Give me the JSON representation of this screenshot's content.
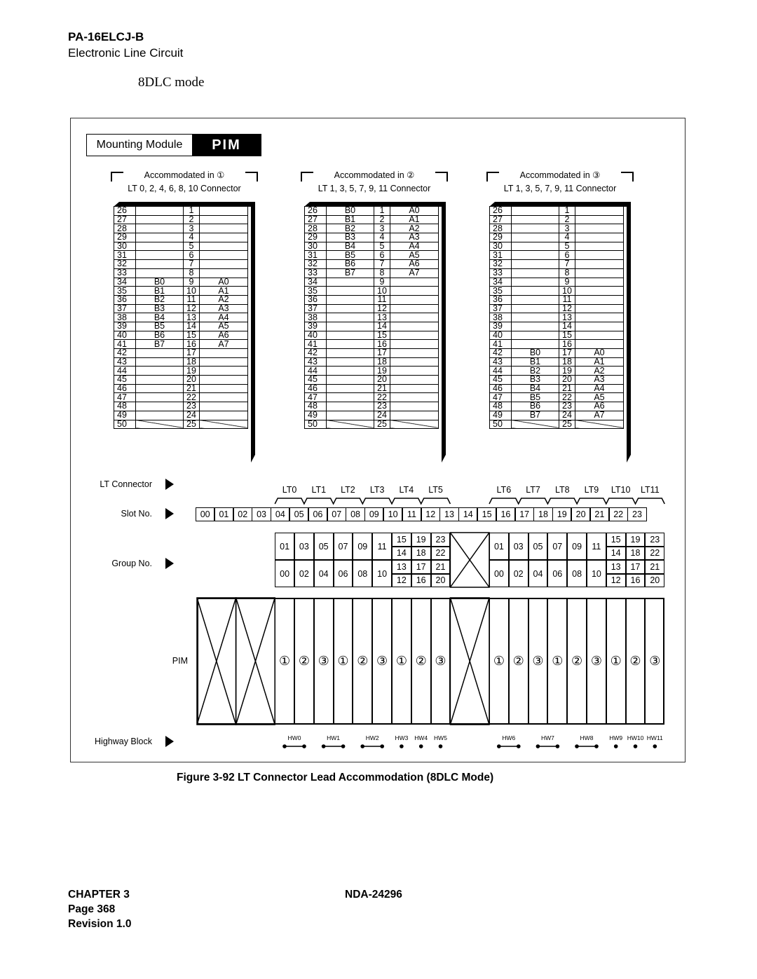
{
  "header": {
    "code": "PA-16ELCJ-B",
    "subtitle": "Electronic Line Circuit",
    "mode": "8DLC mode"
  },
  "mounting_module": {
    "label": "Mounting Module",
    "value": "PIM"
  },
  "connectors": [
    {
      "accommodated": "Accommodated in ①",
      "lt_label": "LT 0, 2, 4, 6, 8, 10 Connector",
      "rows": [
        [
          "26",
          "",
          "1",
          ""
        ],
        [
          "27",
          "",
          "2",
          ""
        ],
        [
          "28",
          "",
          "3",
          ""
        ],
        [
          "29",
          "",
          "4",
          ""
        ],
        [
          "30",
          "",
          "5",
          ""
        ],
        [
          "31",
          "",
          "6",
          ""
        ],
        [
          "32",
          "",
          "7",
          ""
        ],
        [
          "33",
          "",
          "8",
          ""
        ],
        [
          "34",
          "B0",
          "9",
          "A0"
        ],
        [
          "35",
          "B1",
          "10",
          "A1"
        ],
        [
          "36",
          "B2",
          "11",
          "A2"
        ],
        [
          "37",
          "B3",
          "12",
          "A3"
        ],
        [
          "38",
          "B4",
          "13",
          "A4"
        ],
        [
          "39",
          "B5",
          "14",
          "A5"
        ],
        [
          "40",
          "B6",
          "15",
          "A6"
        ],
        [
          "41",
          "B7",
          "16",
          "A7"
        ],
        [
          "42",
          "",
          "17",
          ""
        ],
        [
          "43",
          "",
          "18",
          ""
        ],
        [
          "44",
          "",
          "19",
          ""
        ],
        [
          "45",
          "",
          "20",
          ""
        ],
        [
          "46",
          "",
          "21",
          ""
        ],
        [
          "47",
          "",
          "22",
          ""
        ],
        [
          "48",
          "",
          "23",
          ""
        ],
        [
          "49",
          "",
          "24",
          ""
        ],
        [
          "50",
          "",
          "25",
          ""
        ]
      ]
    },
    {
      "accommodated": "Accommodated in ②",
      "lt_label": "LT 1, 3, 5, 7, 9, 11 Connector",
      "rows": [
        [
          "26",
          "B0",
          "1",
          "A0"
        ],
        [
          "27",
          "B1",
          "2",
          "A1"
        ],
        [
          "28",
          "B2",
          "3",
          "A2"
        ],
        [
          "29",
          "B3",
          "4",
          "A3"
        ],
        [
          "30",
          "B4",
          "5",
          "A4"
        ],
        [
          "31",
          "B5",
          "6",
          "A5"
        ],
        [
          "32",
          "B6",
          "7",
          "A6"
        ],
        [
          "33",
          "B7",
          "8",
          "A7"
        ],
        [
          "34",
          "",
          "9",
          ""
        ],
        [
          "35",
          "",
          "10",
          ""
        ],
        [
          "36",
          "",
          "11",
          ""
        ],
        [
          "37",
          "",
          "12",
          ""
        ],
        [
          "38",
          "",
          "13",
          ""
        ],
        [
          "39",
          "",
          "14",
          ""
        ],
        [
          "40",
          "",
          "15",
          ""
        ],
        [
          "41",
          "",
          "16",
          ""
        ],
        [
          "42",
          "",
          "17",
          ""
        ],
        [
          "43",
          "",
          "18",
          ""
        ],
        [
          "44",
          "",
          "19",
          ""
        ],
        [
          "45",
          "",
          "20",
          ""
        ],
        [
          "46",
          "",
          "21",
          ""
        ],
        [
          "47",
          "",
          "22",
          ""
        ],
        [
          "48",
          "",
          "23",
          ""
        ],
        [
          "49",
          "",
          "24",
          ""
        ],
        [
          "50",
          "",
          "25",
          ""
        ]
      ]
    },
    {
      "accommodated": "Accommodated in ③",
      "lt_label": "LT 1, 3, 5, 7, 9, 11 Connector",
      "rows": [
        [
          "26",
          "",
          "1",
          ""
        ],
        [
          "27",
          "",
          "2",
          ""
        ],
        [
          "28",
          "",
          "3",
          ""
        ],
        [
          "29",
          "",
          "4",
          ""
        ],
        [
          "30",
          "",
          "5",
          ""
        ],
        [
          "31",
          "",
          "6",
          ""
        ],
        [
          "32",
          "",
          "7",
          ""
        ],
        [
          "33",
          "",
          "8",
          ""
        ],
        [
          "34",
          "",
          "9",
          ""
        ],
        [
          "35",
          "",
          "10",
          ""
        ],
        [
          "36",
          "",
          "11",
          ""
        ],
        [
          "37",
          "",
          "12",
          ""
        ],
        [
          "38",
          "",
          "13",
          ""
        ],
        [
          "39",
          "",
          "14",
          ""
        ],
        [
          "40",
          "",
          "15",
          ""
        ],
        [
          "41",
          "",
          "16",
          ""
        ],
        [
          "42",
          "B0",
          "17",
          "A0"
        ],
        [
          "43",
          "B1",
          "18",
          "A1"
        ],
        [
          "44",
          "B2",
          "19",
          "A2"
        ],
        [
          "45",
          "B3",
          "20",
          "A3"
        ],
        [
          "46",
          "B4",
          "21",
          "A4"
        ],
        [
          "47",
          "B5",
          "22",
          "A5"
        ],
        [
          "48",
          "B6",
          "23",
          "A6"
        ],
        [
          "49",
          "B7",
          "24",
          "A7"
        ],
        [
          "50",
          "",
          "25",
          ""
        ]
      ]
    }
  ],
  "row_labels": {
    "lt_connector": "LT Connector",
    "slot_no": "Slot No.",
    "group_no": "Group No.",
    "pim": "PIM",
    "highway_block": "Highway Block"
  },
  "lt_connectors": [
    "LT0",
    "LT1",
    "LT2",
    "LT3",
    "LT4",
    "LT5",
    "LT6",
    "LT7",
    "LT8",
    "LT9",
    "LT10",
    "LT11"
  ],
  "slots": [
    "00",
    "01",
    "02",
    "03",
    "04",
    "05",
    "06",
    "07",
    "08",
    "09",
    "10",
    "11",
    "12",
    "13",
    "14",
    "15",
    "16",
    "17",
    "18",
    "19",
    "20",
    "21",
    "22",
    "23"
  ],
  "groups": {
    "upper": [
      "01",
      "03",
      "05",
      "07",
      "09",
      "11"
    ],
    "lower": [
      "00",
      "02",
      "04",
      "06",
      "08",
      "10"
    ],
    "split": [
      [
        "15",
        "19",
        "23"
      ],
      [
        "14",
        "18",
        "22"
      ],
      [
        "13",
        "17",
        "21"
      ],
      [
        "12",
        "16",
        "20"
      ]
    ]
  },
  "pim_markers": [
    "①",
    "②",
    "③"
  ],
  "highways": [
    "HW0",
    "HW1",
    "HW2",
    "HW3",
    "HW4",
    "HW5",
    "HW6",
    "HW7",
    "HW8",
    "HW9",
    "HW10",
    "HW11"
  ],
  "caption": "Figure 3-92   LT Connector Lead Accommodation (8DLC Mode)",
  "footer": {
    "chapter": "CHAPTER 3",
    "page": "Page 368",
    "revision": "Revision 1.0",
    "doc": "NDA-24296"
  }
}
